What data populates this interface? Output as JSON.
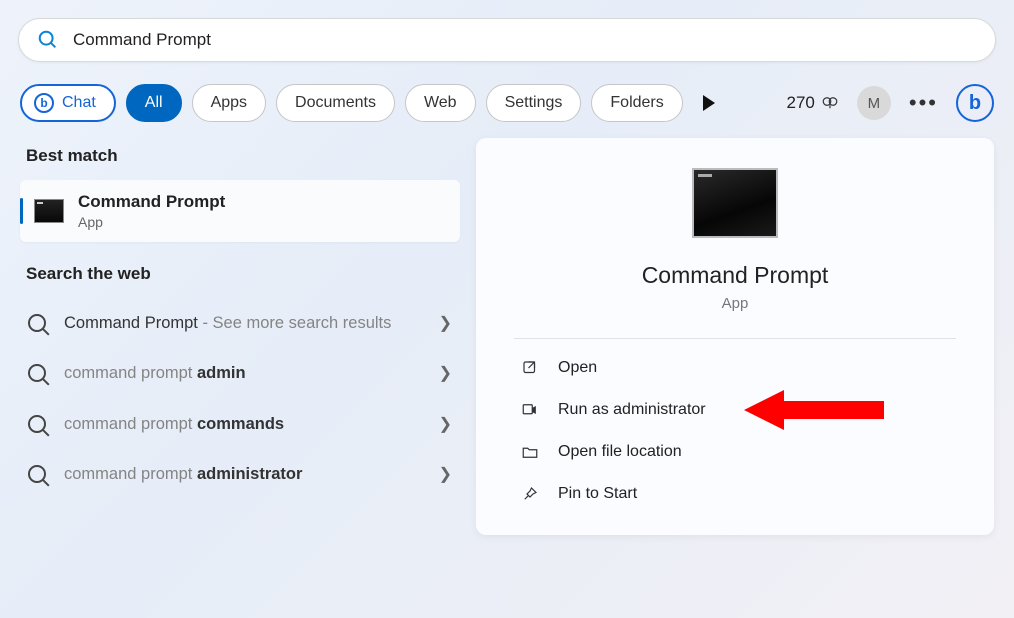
{
  "search": {
    "value": "Command Prompt"
  },
  "filters": {
    "chat": "Chat",
    "chat_icon_letter": "b",
    "all": "All",
    "apps": "Apps",
    "documents": "Documents",
    "web": "Web",
    "settings": "Settings",
    "folders": "Folders"
  },
  "header": {
    "points": "270",
    "avatar_letter": "M",
    "bing_letter": "b"
  },
  "left": {
    "best_match_heading": "Best match",
    "best": {
      "title": "Command Prompt",
      "subtitle": "App"
    },
    "web_heading": "Search the web",
    "items": [
      {
        "prefix": "Command Prompt",
        "suffix": " - See more search results",
        "bold_in_suffix": false
      },
      {
        "prefix": "command prompt ",
        "bold": "admin"
      },
      {
        "prefix": "command prompt ",
        "bold": "commands"
      },
      {
        "prefix": "command prompt ",
        "bold": "administrator"
      }
    ]
  },
  "preview": {
    "title": "Command Prompt",
    "subtitle": "App",
    "actions": {
      "open": "Open",
      "run_admin": "Run as administrator",
      "open_loc": "Open file location",
      "pin": "Pin to Start"
    }
  }
}
